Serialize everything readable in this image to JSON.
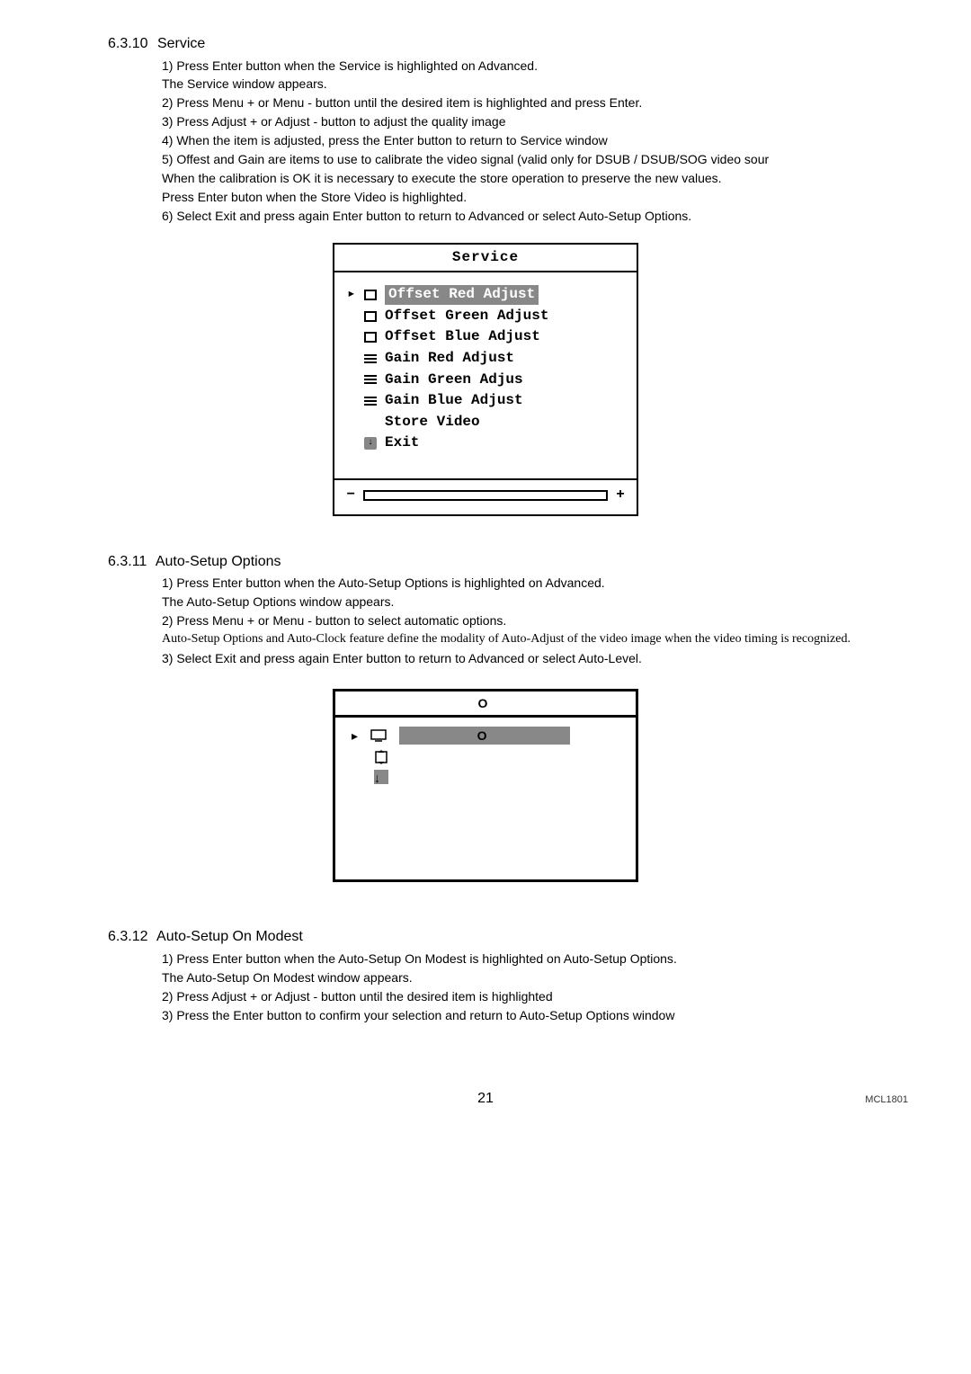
{
  "sections": {
    "s1": {
      "num": "6.3.10",
      "title": "Service",
      "p1a": "1) Press ",
      "p1b": "Enter",
      "p1c": " button when the ",
      "p1d": "Service",
      "p1e": " is highlighted on ",
      "p1f": "Advanced",
      "p1g": ".",
      "p2a": "The ",
      "p2b": "Service",
      "p2c": " window appears.",
      "p3": "2) Press Menu + or Menu - button until the desired item is highlighted and press Enter.",
      "p4": "3) Press Adjust + or Adjust - button to adjust the quality image",
      "p5a": "4) When the item is adjusted, press the ",
      "p5b": "Enter",
      "p5c": " button to return to ",
      "p5d": "Service",
      "p5e": " window",
      "p6": "5) Offest and Gain are items to use to calibrate the video signal (valid only for DSUB / DSUB/SOG video sour",
      "p7": "When the calibration is OK it is necessary to execute the store operation to preserve the new values.",
      "p8a": "Press ",
      "p8b": "Enter",
      "p8c": " buton when the ",
      "p8d": "Store Video",
      "p8e": " is highlighted.",
      "p9a": "6) Select ",
      "p9b": "Exit",
      "p9c": " and press again ",
      "p9d": "Enter",
      "p9e": " button to return to ",
      "p9f": "Advanced",
      "p9g": " or select ",
      "p9h": "Auto-Setup Options",
      "p9i": "."
    },
    "osd1": {
      "title": "Service",
      "items": [
        "Offset Red Adjust",
        "Offset Green Adjust",
        "Offset Blue Adjust",
        "Gain Red Adjust",
        "Gain Green Adjus",
        "Gain Blue Adjust",
        "Store Video",
        "Exit"
      ],
      "minus": "−",
      "plus": "+"
    },
    "s2": {
      "num": "6.3.11",
      "title": "Auto-Setup Options",
      "p1a": "1) Press ",
      "p1b": "Enter",
      "p1c": " button when the ",
      "p1d": "Auto-Setup Options",
      "p1e": " is highlighted on ",
      "p1f": "Advanced",
      "p1g": ".",
      "p2a": "The ",
      "p2b": "Auto-Setup Options",
      "p2c": " window appears.",
      "p3": "2) Press Menu + or Menu - button to select automatic options.",
      "p4": "Auto-Setup Options and Auto-Clock feature define the modality of Auto-Adjust of the video image when the video timing is recognized.",
      "p5a": "3) Select ",
      "p5b": "Exit",
      "p5c": " and press again ",
      "p5d": "Enter",
      "p5e": " button to return to ",
      "p5f": "Advanced",
      "p5g": " or select ",
      "p5h": "Auto-Level",
      "p5i": "."
    },
    "osd2": {
      "title_char": "O",
      "sel_char": "O"
    },
    "s3": {
      "num": "6.3.12",
      "title": "Auto-Setup On Modest",
      "p1a": "1) Press ",
      "p1b": "Enter",
      "p1c": " button when the ",
      "p1d": "Auto-Setup On Modest",
      "p1e": " is highlighted on ",
      "p1f": "Auto-Setup Options",
      "p1g": ".",
      "p2a": "The ",
      "p2b": "Auto-Setup On Modest",
      "p2c": " window appears.",
      "p3": "2) Press Adjust + or Adjust - button until the desired item is highlighted",
      "p4a": "3) Press the ",
      "p4b": "Enter",
      "p4c": " button to confirm your selection and return to ",
      "p4d": "Auto-Setup Options",
      "p4e": " window"
    }
  },
  "page_number": "21",
  "footer_code": "MCL1801"
}
